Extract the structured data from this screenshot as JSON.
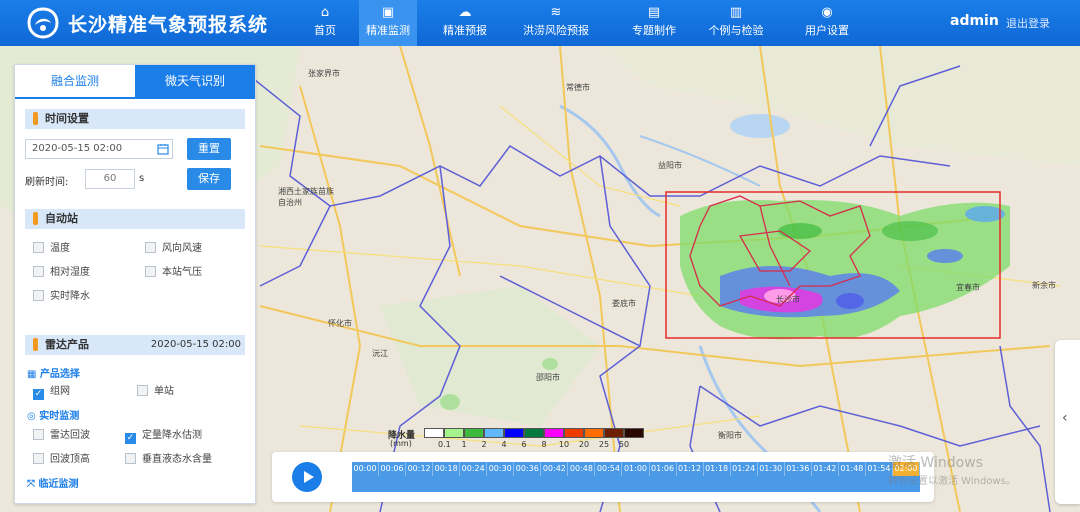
{
  "header": {
    "title": "长沙精准气象预报系统",
    "nav": [
      {
        "label": "首页",
        "icon": "home-icon"
      },
      {
        "label": "精准监测",
        "icon": "monitor-icon",
        "active": true
      },
      {
        "label": "精准预报",
        "icon": "weather-icon"
      },
      {
        "label": "洪涝风险预报",
        "icon": "flood-icon"
      },
      {
        "label": "专题制作",
        "icon": "document-icon"
      },
      {
        "label": "个例与检验",
        "icon": "case-icon"
      },
      {
        "label": "用户设置",
        "icon": "user-icon"
      }
    ],
    "user": "admin",
    "logout": "退出登录"
  },
  "sidebar": {
    "tabs": [
      "融合监测",
      "微天气识别"
    ],
    "active_tab": 1,
    "time_settings": {
      "title": "时间设置",
      "date_value": "2020-05-15 02:00",
      "reset_label": "重置",
      "refresh_label": "刷新时间:",
      "refresh_value": "60",
      "refresh_unit": "s",
      "save_label": "保存"
    },
    "auto_station": {
      "title": "自动站",
      "items": [
        "温度",
        "风向风速",
        "相对湿度",
        "本站气压",
        "实时降水"
      ]
    },
    "radar": {
      "title": "雷达产品",
      "date": "2020-05-15 02:00",
      "product_select": "产品选择",
      "grid": "组网",
      "single": "单站",
      "realtime": "实时监测",
      "items": [
        "雷达回波",
        "定量降水估测",
        "回波顶高",
        "垂直液态水含量"
      ],
      "nowcast": "临近监测"
    }
  },
  "map": {
    "labels": [
      "常德市",
      "益阳市",
      "怀化市",
      "邵阳市",
      "娄底市",
      "衡阳市",
      "宜春市",
      "新余市",
      "长沙市",
      "湘西土家族苗族自治州",
      "张家界市",
      "沅江"
    ]
  },
  "legend": {
    "title": "降水量",
    "unit": "(mm)",
    "values": [
      "0.1",
      "1",
      "2",
      "4",
      "6",
      "8",
      "10",
      "20",
      "25",
      "50"
    ],
    "colors": [
      "#ffffff",
      "#a6f28f",
      "#3dba3d",
      "#61b8ff",
      "#0000ff",
      "#007a3d",
      "#fa00fa",
      "#ee3b00",
      "#ff6c00",
      "#6e1f00",
      "#2a0a00"
    ]
  },
  "timeline": {
    "slots": [
      "00:00",
      "00:06",
      "00:12",
      "00:18",
      "00:24",
      "00:30",
      "00:36",
      "00:42",
      "00:48",
      "00:54",
      "01:00",
      "01:06",
      "01:12",
      "01:18",
      "01:24",
      "01:30",
      "01:36",
      "01:42",
      "01:48",
      "01:54",
      "02:00"
    ],
    "active_index": 20
  },
  "watermark": {
    "line1": "激活 Windows",
    "line2": "转到设置以激活 Windows。"
  }
}
